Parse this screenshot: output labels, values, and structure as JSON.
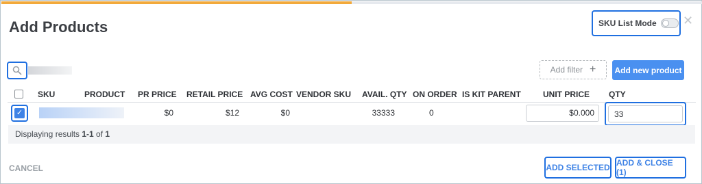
{
  "header": {
    "title": "Add Products",
    "load_progress": 0.5,
    "sku_list_mode": {
      "label": "SKU List Mode",
      "enabled": false
    }
  },
  "toolbar": {
    "add_filter_label": "Add filter",
    "add_new_product_label": "Add new product"
  },
  "table": {
    "columns": [
      "SKU",
      "PRODUCT",
      "PR PRICE",
      "RETAIL PRICE",
      "AVG COST",
      "VENDOR SKU",
      "AVAIL. QTY",
      "ON ORDER",
      "IS KIT PARENT",
      "UNIT PRICE",
      "QTY"
    ],
    "rows": [
      {
        "selected": true,
        "pr_price": "$0",
        "retail_price": "$12",
        "avg_cost": "$0",
        "vendor_sku": "",
        "avail_qty": "33333",
        "on_order": "0",
        "is_kit_parent": "",
        "unit_price": "$0.000",
        "qty": "33"
      }
    ],
    "results": {
      "prefix": "Displaying results ",
      "range": "1-1",
      "middle": " of ",
      "total": "1"
    }
  },
  "footer": {
    "cancel_label": "CANCEL",
    "add_selected_label": "ADD SELECTED",
    "add_close_label": "ADD & CLOSE (1)"
  },
  "colors": {
    "accent": "#4a90f0",
    "progress": "#f2a93b",
    "highlight": "#1f6fe0"
  },
  "icons": [
    "search-icon",
    "close-icon",
    "plus-icon",
    "check-icon"
  ]
}
